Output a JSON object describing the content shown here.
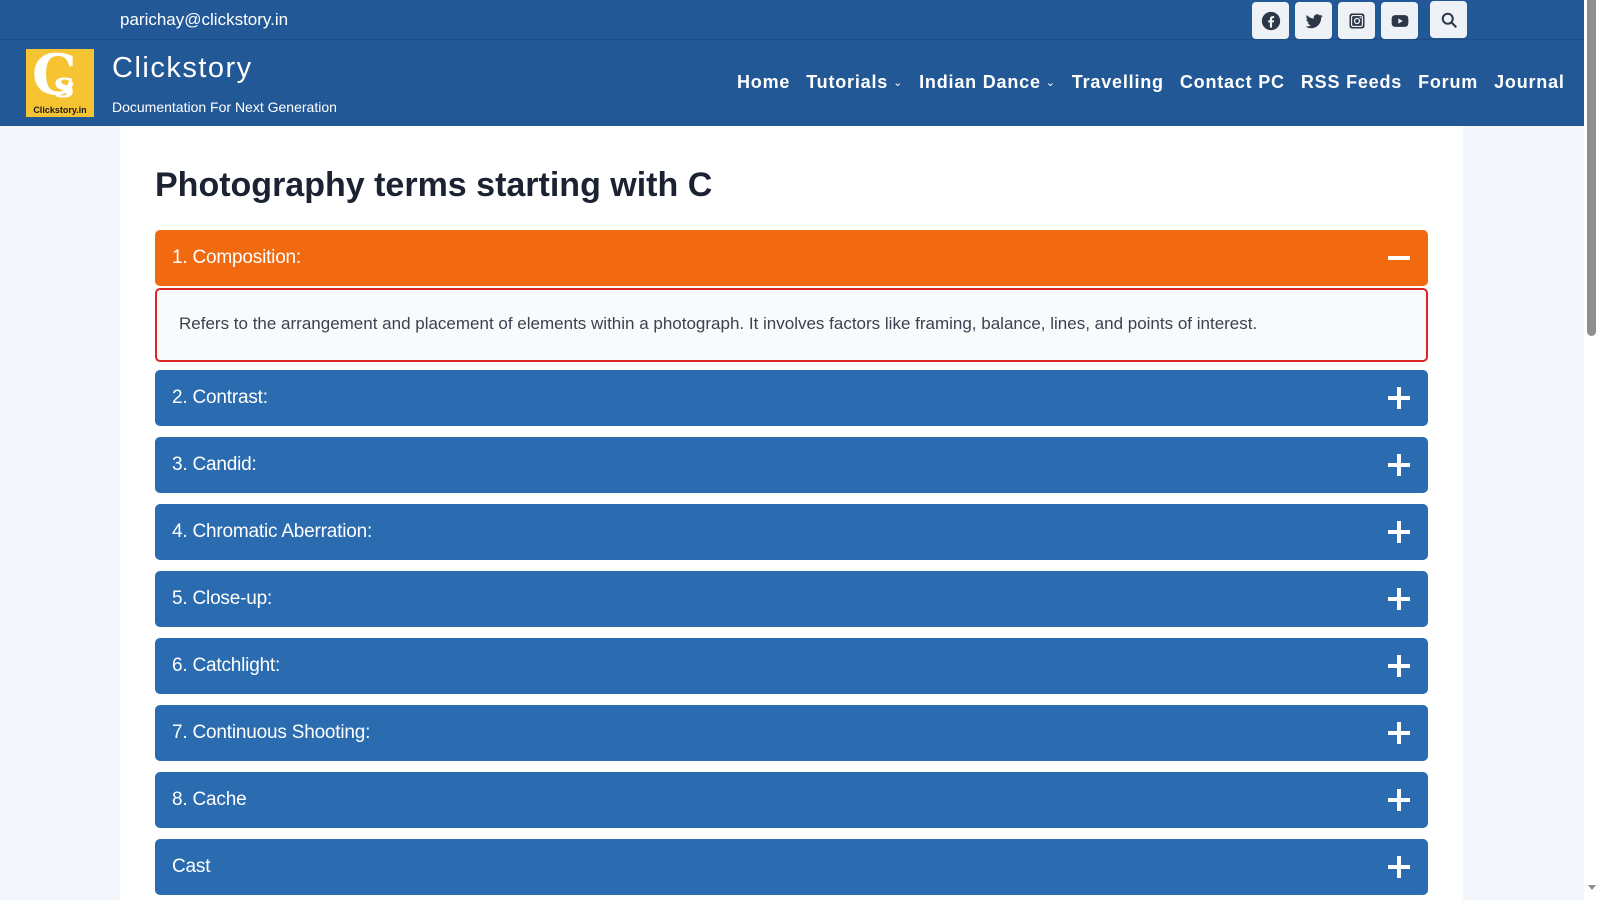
{
  "topbar": {
    "email": "parichay@clickstory.in",
    "social": [
      {
        "name": "facebook-icon",
        "label": "Facebook"
      },
      {
        "name": "twitter-icon",
        "label": "Twitter"
      },
      {
        "name": "instagram-icon",
        "label": "Instagram"
      },
      {
        "name": "youtube-icon",
        "label": "YouTube"
      }
    ],
    "search_icon": "search-icon"
  },
  "header": {
    "logo_text": "Clickstory.in",
    "logo_letters": "CS",
    "site_title": "Clickstory",
    "tagline": "Documentation For Next Generation"
  },
  "nav": {
    "items": [
      {
        "label": "Home",
        "dropdown": false
      },
      {
        "label": "Tutorials",
        "dropdown": true
      },
      {
        "label": "Indian Dance",
        "dropdown": true
      },
      {
        "label": "Travelling",
        "dropdown": false
      },
      {
        "label": "Contact PC",
        "dropdown": false
      },
      {
        "label": "RSS Feeds",
        "dropdown": false
      },
      {
        "label": "Forum",
        "dropdown": false
      },
      {
        "label": "Journal",
        "dropdown": false
      }
    ]
  },
  "main": {
    "title": "Photography terms starting with C",
    "accordion": [
      {
        "label": "1. Composition:",
        "expanded": true,
        "body": "Refers to the arrangement and placement of elements within a photograph. It involves factors like framing, balance, lines, and points of interest."
      },
      {
        "label": "2. Contrast:",
        "expanded": false
      },
      {
        "label": "3. Candid:",
        "expanded": false
      },
      {
        "label": "4. Chromatic Aberration:",
        "expanded": false
      },
      {
        "label": "5. Close-up:",
        "expanded": false
      },
      {
        "label": "6. Catchlight:",
        "expanded": false
      },
      {
        "label": "7. Continuous Shooting:",
        "expanded": false
      },
      {
        "label": "8. Cache",
        "expanded": false
      },
      {
        "label": "Cast",
        "expanded": false
      }
    ]
  },
  "colors": {
    "header_bg": "#235896",
    "accordion_active": "#f26a10",
    "accordion_inactive": "#2b6cb0",
    "panel_border": "#dc2626",
    "logo_bg": "#f6c333"
  }
}
